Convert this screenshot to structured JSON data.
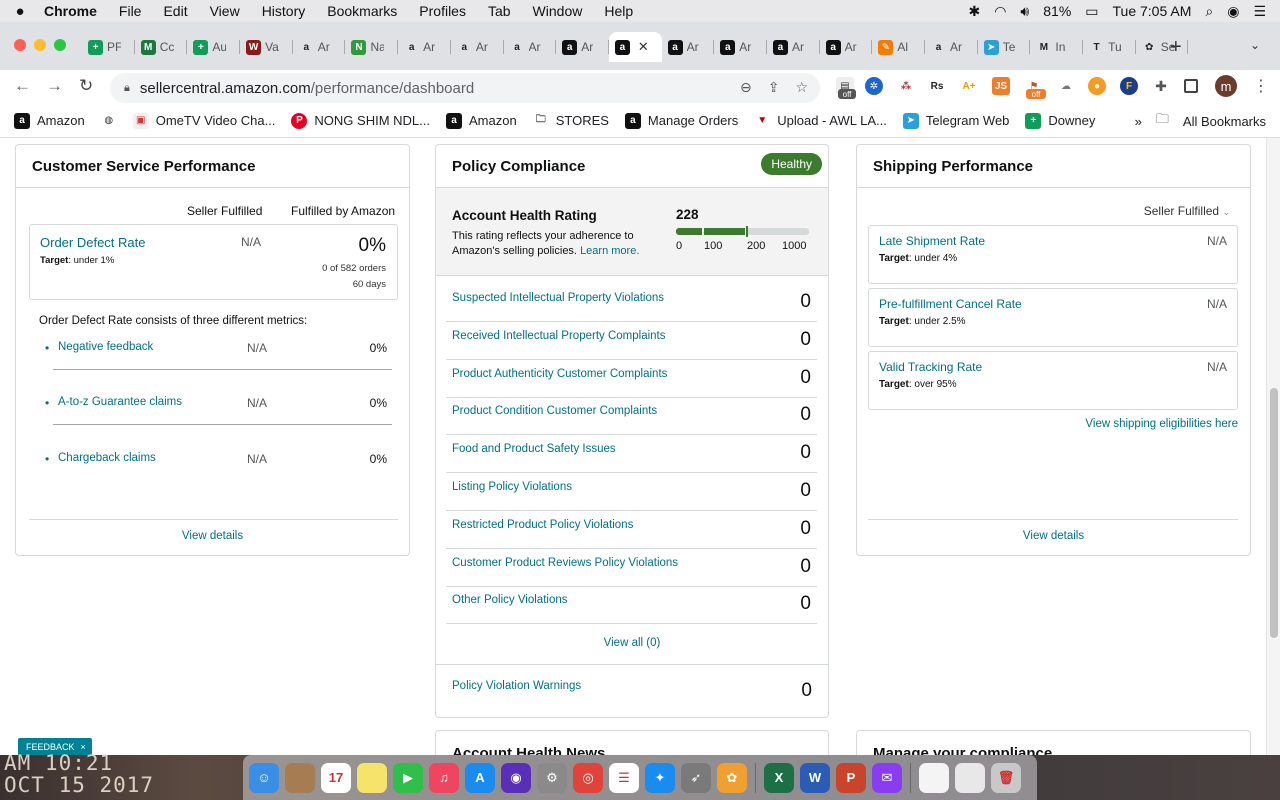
{
  "menubar": {
    "app_name": "Chrome",
    "items": [
      "File",
      "Edit",
      "View",
      "History",
      "Bookmarks",
      "Profiles",
      "Tab",
      "Window",
      "Help"
    ],
    "battery": "81%",
    "clock": "Tue 7:05 AM"
  },
  "tabs": [
    {
      "icon": "sheets-icon",
      "label": "PF",
      "color": "#0f9d58",
      "glyph": "+"
    },
    {
      "icon": "m-icon",
      "label": "Cc",
      "color": "#1b7a3a",
      "glyph": "M"
    },
    {
      "icon": "sheets-icon",
      "label": "Au",
      "color": "#0f9d58",
      "glyph": "+"
    },
    {
      "icon": "w-icon",
      "label": "Va",
      "color": "#8b1a1a",
      "glyph": "W"
    },
    {
      "icon": "amazon-icon",
      "label": "Ar",
      "color": "#ffffff",
      "glyph": "a"
    },
    {
      "icon": "n-icon",
      "label": "Na",
      "color": "#2e9a3a",
      "glyph": "N"
    },
    {
      "icon": "amazon-icon",
      "label": "Ar",
      "color": "#ffffff",
      "glyph": "a"
    },
    {
      "icon": "amazon-icon",
      "label": "Ar",
      "color": "#ffffff",
      "glyph": "a"
    },
    {
      "icon": "amazon-icon",
      "label": "Ar",
      "color": "#ffffff",
      "glyph": "a"
    },
    {
      "icon": "amazon-icon",
      "label": "Ar",
      "color": "#111111",
      "glyph": "a"
    },
    {
      "icon": "amazon-icon",
      "label": "",
      "color": "#111111",
      "glyph": "a",
      "active": true
    },
    {
      "icon": "amazon-icon",
      "label": "Ar",
      "color": "#111111",
      "glyph": "a"
    },
    {
      "icon": "amazon-icon",
      "label": "Ar",
      "color": "#111111",
      "glyph": "a"
    },
    {
      "icon": "amazon-icon",
      "label": "Ar",
      "color": "#111111",
      "glyph": "a"
    },
    {
      "icon": "amazon-icon",
      "label": "Ar",
      "color": "#111111",
      "glyph": "a"
    },
    {
      "icon": "pen-icon",
      "label": "Al",
      "color": "#f57c00",
      "glyph": "✎"
    },
    {
      "icon": "amazon-icon",
      "label": "Ar",
      "color": "#ffffff",
      "glyph": "a"
    },
    {
      "icon": "telegram-icon",
      "label": "Te",
      "color": "#2aa1da",
      "glyph": "➤"
    },
    {
      "icon": "gmail-icon",
      "label": "In",
      "color": "#ffffff",
      "glyph": "M"
    },
    {
      "icon": "t-icon",
      "label": "Tu",
      "color": "#ffffff",
      "glyph": "T"
    },
    {
      "icon": "leaf-icon",
      "label": "Se",
      "color": "#ffffff",
      "glyph": "✿"
    }
  ],
  "address": {
    "host": "sellercentral.amazon.com",
    "path": "/performance/dashboard"
  },
  "extensions": {
    "off_badge": "off",
    "avatar_letter": "m"
  },
  "bookmarks": [
    {
      "label": "Amazon",
      "icon": "amazon-icon"
    },
    {
      "label": "",
      "icon": "globe-icon"
    },
    {
      "label": "OmeTV Video Cha...",
      "icon": "ometv-icon"
    },
    {
      "label": "NONG SHIM NDL...",
      "icon": "pinterest-icon"
    },
    {
      "label": "Amazon",
      "icon": "amazon-icon"
    },
    {
      "label": "STORES",
      "icon": "folder-icon"
    },
    {
      "label": "Manage Orders",
      "icon": "amazon-icon"
    },
    {
      "label": "Upload - AWL LA...",
      "icon": "awl-icon"
    },
    {
      "label": "Telegram Web",
      "icon": "telegram-icon"
    },
    {
      "label": "Downey",
      "icon": "sheets-icon"
    }
  ],
  "bookmarks_more": "»",
  "all_bookmarks": "All Bookmarks",
  "csp": {
    "title": "Customer Service Performance",
    "col_seller": "Seller Fulfilled",
    "col_fba": "Fulfilled by Amazon",
    "odr": {
      "label": "Order Defect Rate",
      "target_prefix": "Target",
      "target": ": under 1%",
      "seller_value": "N/A",
      "fba_value": "0%",
      "orders": "0 of 582 orders",
      "period": "60 days"
    },
    "consists": "Order Defect Rate consists of three different metrics:",
    "metrics": [
      {
        "label": "Negative feedback",
        "seller": "N/A",
        "fba": "0%"
      },
      {
        "label": "A-to-z Guarantee claims",
        "seller": "N/A",
        "fba": "0%"
      },
      {
        "label": "Chargeback claims",
        "seller": "N/A",
        "fba": "0%"
      }
    ],
    "view_details": "View details"
  },
  "policy": {
    "title": "Policy Compliance",
    "status_badge": "Healthy",
    "ahr_title": "Account Health Rating",
    "ahr_desc_1": "This rating reflects your adherence to",
    "ahr_desc_2": "Amazon's selling policies.",
    "learn_more": "Learn more.",
    "score": "228",
    "score_fraction": 0.228,
    "scale": [
      "0",
      "100",
      "200",
      "1000"
    ],
    "items": [
      {
        "label": "Suspected Intellectual Property Violations",
        "value": "0"
      },
      {
        "label": "Received Intellectual Property Complaints",
        "value": "0"
      },
      {
        "label": "Product Authenticity Customer Complaints",
        "value": "0"
      },
      {
        "label": "Product Condition Customer Complaints",
        "value": "0"
      },
      {
        "label": "Food and Product Safety Issues",
        "value": "0"
      },
      {
        "label": "Listing Policy Violations",
        "value": "0"
      },
      {
        "label": "Restricted Product Policy Violations",
        "value": "0"
      },
      {
        "label": "Customer Product Reviews Policy Violations",
        "value": "0"
      },
      {
        "label": "Other Policy Violations",
        "value": "0"
      }
    ],
    "view_all": "View all (0)",
    "warnings_label": "Policy Violation Warnings",
    "warnings_value": "0",
    "healthy_color": "#3c7a2d"
  },
  "shipping": {
    "title": "Shipping Performance",
    "filter": "Seller Fulfilled",
    "items": [
      {
        "label": "Late Shipment Rate",
        "target_prefix": "Target",
        "target": ": under 4%",
        "value": "N/A"
      },
      {
        "label": "Pre-fulfillment Cancel Rate",
        "target_prefix": "Target",
        "target": ": under 2.5%",
        "value": "N/A"
      },
      {
        "label": "Valid Tracking Rate",
        "target_prefix": "Target",
        "target": ": over 95%",
        "value": "N/A"
      }
    ],
    "eligibilities_link": "View shipping eligibilities here",
    "view_details": "View details"
  },
  "lower": {
    "left_partial": "Account Health News",
    "right_partial": "Manage your compliance"
  },
  "feedback": {
    "label": "FEEDBACK",
    "close": "×"
  },
  "desktop_text": {
    "line1": "AM 10:21",
    "line2": "OCT 15 2017"
  },
  "dock": [
    {
      "name": "finder-icon",
      "color": "#3a8ee6",
      "glyph": "☺"
    },
    {
      "name": "notes-folder-icon",
      "color": "#a67c52",
      "glyph": ""
    },
    {
      "name": "calendar-icon",
      "color": "#ffffff",
      "glyph": "17"
    },
    {
      "name": "notes-icon",
      "color": "#f5e36b",
      "glyph": ""
    },
    {
      "name": "facetime-icon",
      "color": "#2fbf4a",
      "glyph": "▶"
    },
    {
      "name": "music-icon",
      "color": "#f04560",
      "glyph": "♫"
    },
    {
      "name": "app-store-icon",
      "color": "#1a8cf0",
      "glyph": "A"
    },
    {
      "name": "siri-icon",
      "color": "#5a2fb8",
      "glyph": "◉"
    },
    {
      "name": "system-preferences-icon",
      "color": "#8a8a8a",
      "glyph": "⚙"
    },
    {
      "name": "chrome-icon",
      "color": "#e0433a",
      "glyph": "◎"
    },
    {
      "name": "reminders-icon",
      "color": "#ffffff",
      "glyph": "☰"
    },
    {
      "name": "safari-icon",
      "color": "#1a8cf0",
      "glyph": "✦"
    },
    {
      "name": "launchpad-icon",
      "color": "#7a7a7a",
      "glyph": "➶"
    },
    {
      "name": "photos-icon",
      "color": "#f0a030",
      "glyph": "✿"
    },
    {
      "name": "sep",
      "color": "",
      "glyph": ""
    },
    {
      "name": "excel-icon",
      "color": "#1d7044",
      "glyph": "X"
    },
    {
      "name": "word-icon",
      "color": "#2b5cb5",
      "glyph": "W"
    },
    {
      "name": "powerpoint-icon",
      "color": "#c8452c",
      "glyph": "P"
    },
    {
      "name": "messenger-icon",
      "color": "#8a3cf0",
      "glyph": "✉"
    },
    {
      "name": "sep",
      "color": "",
      "glyph": ""
    },
    {
      "name": "document-icon",
      "color": "#f4f4f4",
      "glyph": ""
    },
    {
      "name": "document-stack-icon",
      "color": "#e8e8e8",
      "glyph": ""
    },
    {
      "name": "trash-icon",
      "color": "#c8c8c8",
      "glyph": "🗑"
    }
  ],
  "colors": {
    "link": "#007185",
    "healthy": "#3c7a2d",
    "feedback": "#008296"
  }
}
